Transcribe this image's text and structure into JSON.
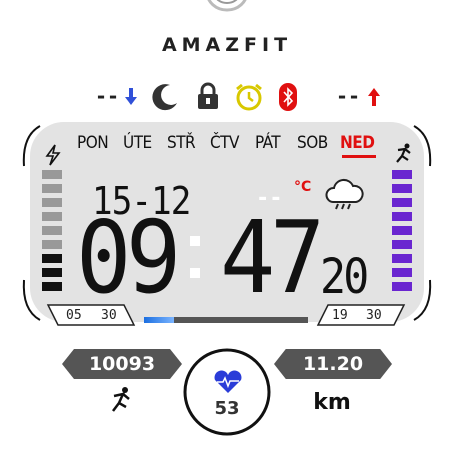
{
  "brand": "AMAZFIT",
  "status": {
    "left_dash": "--",
    "right_dash": "--",
    "icons": [
      "down-arrow-icon",
      "moon-icon",
      "lock-icon",
      "alarm-icon",
      "bluetooth-icon",
      "up-arrow-icon"
    ]
  },
  "days": [
    "PON",
    "ÚTE",
    "STŘ",
    "ČTV",
    "PÁT",
    "SOB",
    "NED"
  ],
  "active_day": "NED",
  "date": "15-12",
  "temperature": "--",
  "temperature_unit": "°C",
  "weather_icon": "thunderstorm-cloud-icon",
  "time": {
    "hours": "09",
    "minutes": "47",
    "seconds": "20"
  },
  "sunrise": {
    "hour": "05",
    "minute": "30"
  },
  "sunset": {
    "hour": "19",
    "minute": "30"
  },
  "day_progress": 0.18,
  "battery_level_left": 0.3,
  "battery_level_right": 0.85,
  "steps": "10093",
  "distance": "11.20",
  "distance_unit": "km",
  "heart_rate": "53",
  "colors": {
    "accent_red": "#e01010",
    "accent_purple": "#6a26d0",
    "progress_blue": "#1c6fe0",
    "pill_gray": "#555555",
    "lcd_bg": "#e3e3e3"
  }
}
